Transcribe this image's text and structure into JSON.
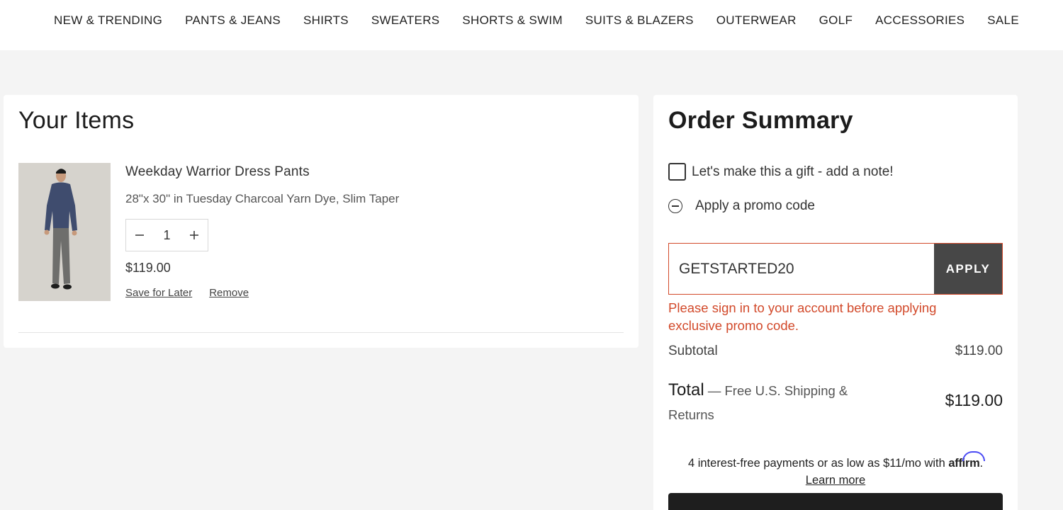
{
  "nav": {
    "items": [
      "NEW & TRENDING",
      "PANTS & JEANS",
      "SHIRTS",
      "SWEATERS",
      "SHORTS & SWIM",
      "SUITS & BLAZERS",
      "OUTERWEAR",
      "GOLF",
      "ACCESSORIES",
      "SALE"
    ]
  },
  "cart": {
    "title": "Your Items",
    "item": {
      "name": "Weekday Warrior Dress Pants",
      "variant": "28\"x 30\" in Tuesday Charcoal Yarn Dye, Slim Taper",
      "quantity": "1",
      "price": "$119.00",
      "save_label": "Save for Later",
      "remove_label": "Remove"
    }
  },
  "summary": {
    "title": "Order Summary",
    "gift_label": "Let's make this a gift - add a note!",
    "promo_label": "Apply a promo code",
    "promo_value": "GETSTARTED20",
    "apply_label": "APPLY",
    "promo_error": "Please sign in to your account before applying exclusive promo code.",
    "subtotal_label": "Subtotal",
    "subtotal_value": "$119.00",
    "total_label": "Total",
    "total_note": "— Free U.S. Shipping & Returns",
    "total_value": "$119.00",
    "affirm_text": "4 interest-free payments or as low as $11/mo with",
    "affirm_brand": "affirm",
    "learn_more": "Learn more"
  },
  "colors": {
    "error": "#d2492a",
    "apply_bg": "#474747",
    "affirm_accent": "#4a4af4"
  },
  "icons": [
    "minus-icon",
    "plus-icon",
    "minus-circle-icon",
    "checkbox"
  ]
}
